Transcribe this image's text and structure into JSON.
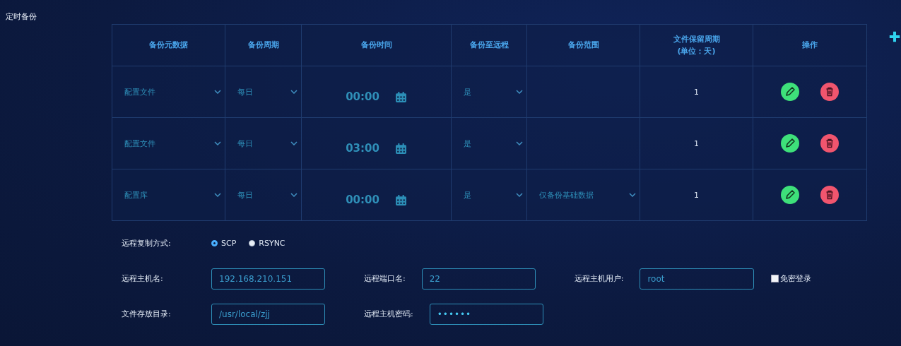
{
  "title": "定时备份",
  "table": {
    "columns": [
      "备份元数据",
      "备份周期",
      "备份时间",
      "备份至远程",
      "备份范围",
      "文件保留周期\n(单位：天)",
      "操作"
    ],
    "rows": [
      {
        "metadata": "配置文件",
        "period": "每日",
        "time": "00:00",
        "remote": "是",
        "retention": "1"
      },
      {
        "metadata": "配置文件",
        "period": "每日",
        "time": "03:00",
        "remote": "是",
        "retention": "1"
      },
      {
        "metadata": "配置库",
        "period": "每日",
        "time": "00:00",
        "remote": "是",
        "scope": "仅备份基础数据",
        "retention": "1"
      }
    ]
  },
  "copy_mode": {
    "label": "远程复制方式:",
    "options": [
      {
        "label": "SCP",
        "selected": true
      },
      {
        "label": "RSYNC",
        "selected": false
      }
    ]
  },
  "host": {
    "label": "远程主机名:",
    "value": "192.168.210.151"
  },
  "port": {
    "label": "远程端口名:",
    "value": "22"
  },
  "user": {
    "label": "远程主机用户:",
    "value": "root"
  },
  "passwordless": {
    "label": "免密登录",
    "checked": false
  },
  "directory": {
    "label": "文件存放目录:",
    "value": "/usr/local/zjj"
  },
  "password": {
    "label": "远程主机密码:",
    "value": "••••••"
  }
}
